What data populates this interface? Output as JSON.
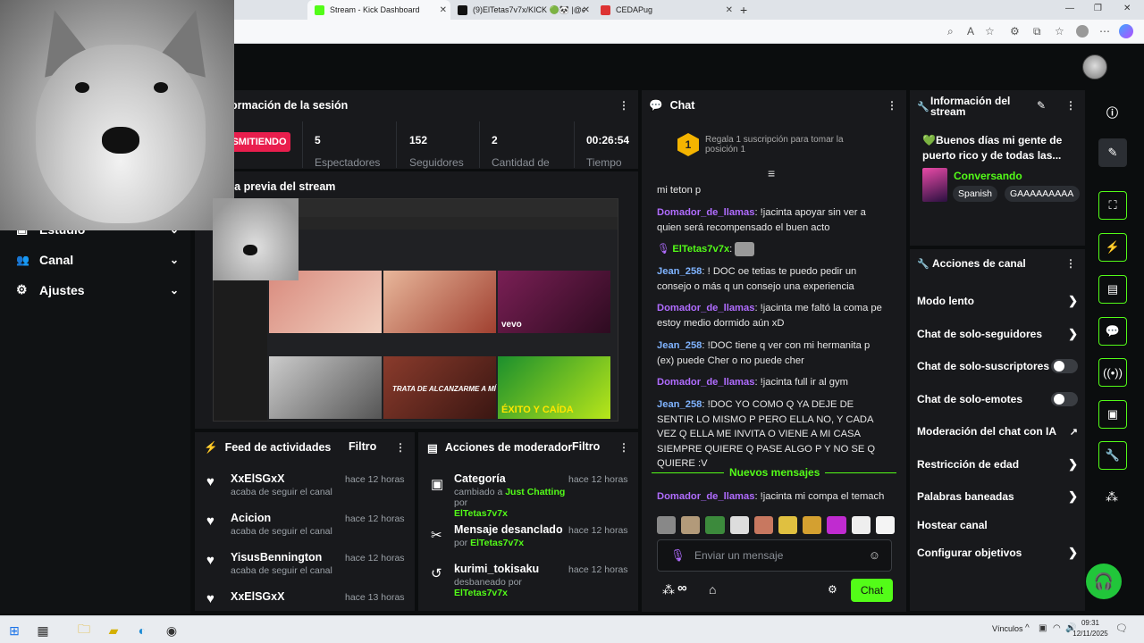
{
  "browser": {
    "tabs": [
      {
        "title": "Stream - Kick Dashboard",
        "active": true
      },
      {
        "title": "(9)ElTetas7v7x/KICK 🟢🐼 |@elta",
        "active": false
      },
      {
        "title": "CEDAPug",
        "active": false
      }
    ]
  },
  "sidebar": {
    "items": [
      {
        "label": "Estudio"
      },
      {
        "label": "Canal"
      },
      {
        "label": "Ajustes"
      }
    ]
  },
  "session": {
    "title": "ormación de la sesión",
    "live_badge": "SMITIENDO",
    "stats": [
      {
        "value": "5",
        "label": "Espectadores"
      },
      {
        "value": "152",
        "label": "Seguidores"
      },
      {
        "value": "2",
        "label": "Cantidad de"
      },
      {
        "value": "00:26:54",
        "label": "Tiempo"
      }
    ]
  },
  "preview": {
    "title": "ta previa del stream",
    "video_caption_1": "TRATA DE ALCANZARME A MÍ",
    "video_caption_2": "ÉXITO Y CAÍDA",
    "vevo": "vevo"
  },
  "feed": {
    "title": "Feed de actividades",
    "filter": "Filtro",
    "items": [
      {
        "user": "XxElSGxX",
        "action": "acaba de seguir el canal",
        "time": "hace 12 horas"
      },
      {
        "user": "Acicion",
        "action": "acaba de seguir el canal",
        "time": "hace 12 horas"
      },
      {
        "user": "YisusBennington",
        "action": "acaba de seguir el canal",
        "time": "hace 12 horas"
      },
      {
        "user": "XxElSGxX",
        "action": "",
        "time": "hace 13 horas"
      }
    ]
  },
  "modactions": {
    "title": "Acciones de moderador",
    "filter": "Filtro",
    "items": [
      {
        "title": "Categoría",
        "line_prefix": "cambiado a",
        "highlight": "Just Chatting",
        "line_suffix": "por",
        "by": "ElTetas7v7x",
        "time": "hace 12 horas"
      },
      {
        "title": "Mensaje desanclado",
        "line_prefix": "por",
        "by": "ElTetas7v7x",
        "time": "hace 12 horas"
      },
      {
        "title": "kurimi_tokisaku",
        "line_prefix": "desbaneado por",
        "by": "ElTetas7v7x",
        "time": "hace 12 horas"
      }
    ]
  },
  "chat": {
    "title": "Chat",
    "gift_rank": "1",
    "gift_text": "Regala 1 suscripción para tomar la posición 1",
    "messages": [
      {
        "user": "",
        "text": "mi teton p"
      },
      {
        "user": "Domador_de_llamas",
        "text": "!jacinta apoyar sin ver a quien será recompensado el buen acto"
      },
      {
        "user": "ElTetas7v7x",
        "text": ""
      },
      {
        "user": "Jean_258",
        "text": "! DOC oe tetias te puedo pedir un consejo o más q un consejo una experiencia"
      },
      {
        "user": "Domador_de_llamas",
        "text": "!jacinta me faltó la coma pe estoy medio dormido aún xD"
      },
      {
        "user": "Jean_258",
        "text": "!DOC tiene q ver con mi hermanita p (ex) puede Cher o no puede cher"
      },
      {
        "user": "Domador_de_llamas",
        "text": "!jacinta full ir al gym"
      },
      {
        "user": "Jean_258",
        "text": "!DOC YO COMO Q YA DEJE DE SENTIR LO MISMO P PERO ELLA NO, Y CADA VEZ Q ELLA ME INVITA O VIENE A MI CASA SIEMPRE QUIERE Q PASE ALGO P Y NO SE Q QUIERE :V"
      },
      {
        "user": "Domador_de_llamas",
        "text": "!jacinta mi compa el temach"
      }
    ],
    "new_messages": "Nuevos mensajes",
    "input_placeholder": "Enviar un mensaje",
    "send_label": "Chat",
    "infinity": "∞"
  },
  "streaminfo": {
    "title": "Información del stream",
    "stream_title": "💚Buenos días mi gente de puerto rico y de todas las...",
    "category": "Conversando",
    "tags": [
      "Spanish",
      "GAAAAAAAAA"
    ]
  },
  "channel_actions": {
    "title": "Acciones de canal",
    "items": [
      {
        "label": "Modo lento",
        "kind": "arrow"
      },
      {
        "label": "Chat de solo-seguidores",
        "kind": "arrow"
      },
      {
        "label": "Chat de solo-suscriptores",
        "kind": "toggle"
      },
      {
        "label": "Chat de solo-emotes",
        "kind": "toggle"
      },
      {
        "label": "Moderación del chat con IA",
        "kind": "external"
      },
      {
        "label": "Restricción de edad",
        "kind": "arrow"
      },
      {
        "label": "Palabras baneadas",
        "kind": "arrow"
      },
      {
        "label": "Hostear canal",
        "kind": "none"
      },
      {
        "label": "Configurar objetivos",
        "kind": "arrow"
      }
    ]
  },
  "taskbar": {
    "tray_label": "Vínculos",
    "time": "09:31",
    "date": "12/11/2025"
  },
  "colors": {
    "accent": "#53fc18",
    "live": "#e91e4d",
    "username": "#b06cff"
  }
}
